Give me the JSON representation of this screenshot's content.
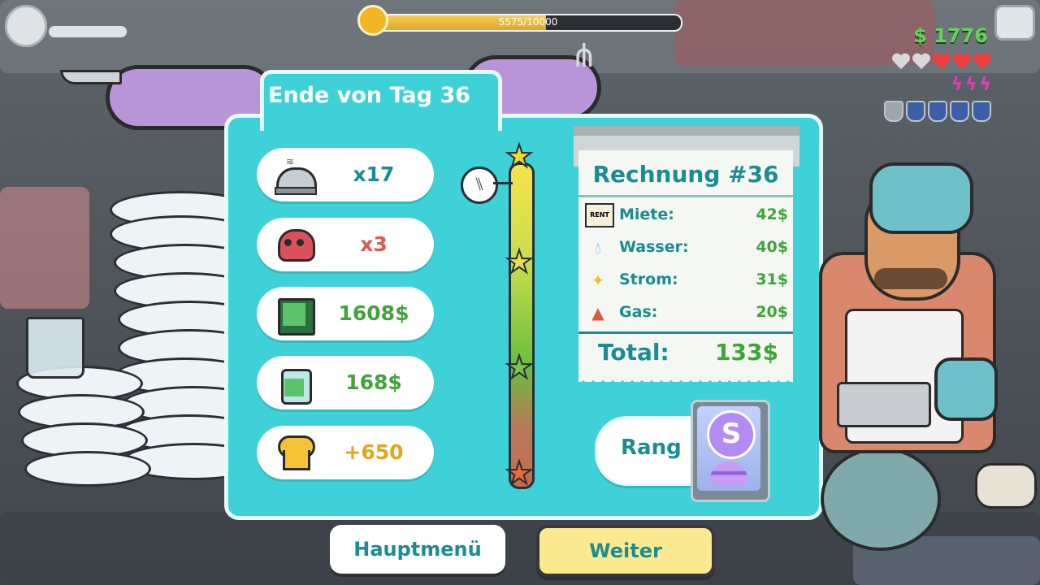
{
  "xp": {
    "text": "5575/10000",
    "fraction": 0.5575
  },
  "hud": {
    "money": "$ 1776",
    "hearts": {
      "filled": 3,
      "total": 5
    },
    "bolts": [
      "ϟ",
      "ϟ",
      "ϟ"
    ],
    "badges": {
      "filled": 4,
      "total": 5
    }
  },
  "summary": {
    "title": "Ende von Tag 36",
    "stats": [
      {
        "icon": "cloche-icon",
        "value": "x17",
        "color": "#1b8c93"
      },
      {
        "icon": "skull-icon",
        "value": "x3",
        "color": "#e0584f"
      },
      {
        "icon": "cash-register-icon",
        "value": "1608$",
        "color": "#3fa53b"
      },
      {
        "icon": "tip-jar-icon",
        "value": "168$",
        "color": "#3fa53b"
      },
      {
        "icon": "chef-hat-icon",
        "value": "+650",
        "color": "#e0a71c"
      }
    ]
  },
  "meter": {
    "stars": [
      "heart-eyes-star",
      "sad-star",
      "dead-star",
      "angry-star"
    ],
    "level": 0.92
  },
  "bill": {
    "title": "Rechnung #36",
    "rows": [
      {
        "icon": "rent-sign-icon",
        "icon_text": "RENT",
        "label": "Miete:",
        "value": "42$"
      },
      {
        "icon": "water-drop-icon",
        "label": "Wasser:",
        "value": "40$"
      },
      {
        "icon": "light-bulb-icon",
        "label": "Strom:",
        "value": "31$"
      },
      {
        "icon": "gas-burner-icon",
        "label": "Gas:",
        "value": "20$"
      }
    ],
    "total_label": "Total:",
    "total_value": "133$"
  },
  "rank": {
    "label": "Rang",
    "letter": "S"
  },
  "buttons": {
    "menu": "Hauptmenü",
    "next": "Weiter"
  },
  "colors": {
    "panel": "#3ed1d8",
    "accent_teal": "#1b8c93",
    "money_green": "#3fa53b",
    "next_button": "#fbe98f"
  }
}
